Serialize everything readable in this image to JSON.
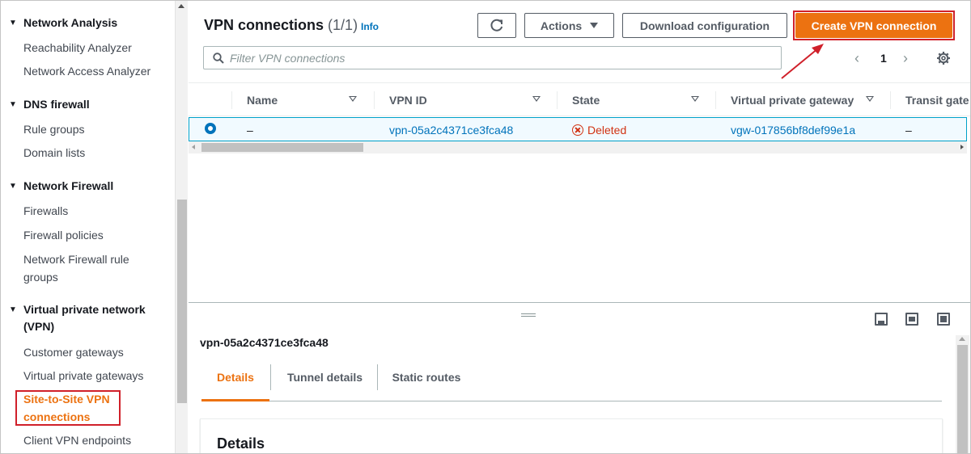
{
  "sidebar": {
    "sections": [
      {
        "title": "Network Analysis",
        "items": [
          "Reachability Analyzer",
          "Network Access Analyzer"
        ]
      },
      {
        "title": "DNS firewall",
        "items": [
          "Rule groups",
          "Domain lists"
        ]
      },
      {
        "title": "Network Firewall",
        "items": [
          "Firewalls",
          "Firewall policies",
          "Network Firewall rule",
          "groups"
        ]
      },
      {
        "title_line1": "Virtual private network",
        "title_line2": "(VPN)",
        "items": [
          "Customer gateways",
          "Virtual private gateways",
          "Site-to-Site VPN",
          "connections",
          "Client VPN endpoints"
        ]
      }
    ]
  },
  "header": {
    "title": "VPN connections",
    "count": "(1/1)",
    "info": "Info",
    "actions_label": "Actions",
    "download_label": "Download configuration",
    "create_label": "Create VPN connection"
  },
  "filter": {
    "placeholder": "Filter VPN connections"
  },
  "pagination": {
    "page": "1",
    "prev": "‹",
    "next": "›"
  },
  "table": {
    "columns": [
      "Name",
      "VPN ID",
      "State",
      "Virtual private gateway",
      "Transit gate"
    ],
    "rows": [
      {
        "name": "–",
        "vpn_id": "vpn-05a2c4371ce3fca48",
        "state": "Deleted",
        "vgw": "vgw-017856bf8def99e1a",
        "transit": "–"
      }
    ]
  },
  "detail_panel": {
    "title": "vpn-05a2c4371ce3fca48",
    "tabs": [
      "Details",
      "Tunnel details",
      "Static routes"
    ],
    "section_title": "Details"
  },
  "colors": {
    "accent": "#ec7211",
    "link": "#0073bb",
    "error": "#d13212",
    "annotation": "#d0202a"
  }
}
